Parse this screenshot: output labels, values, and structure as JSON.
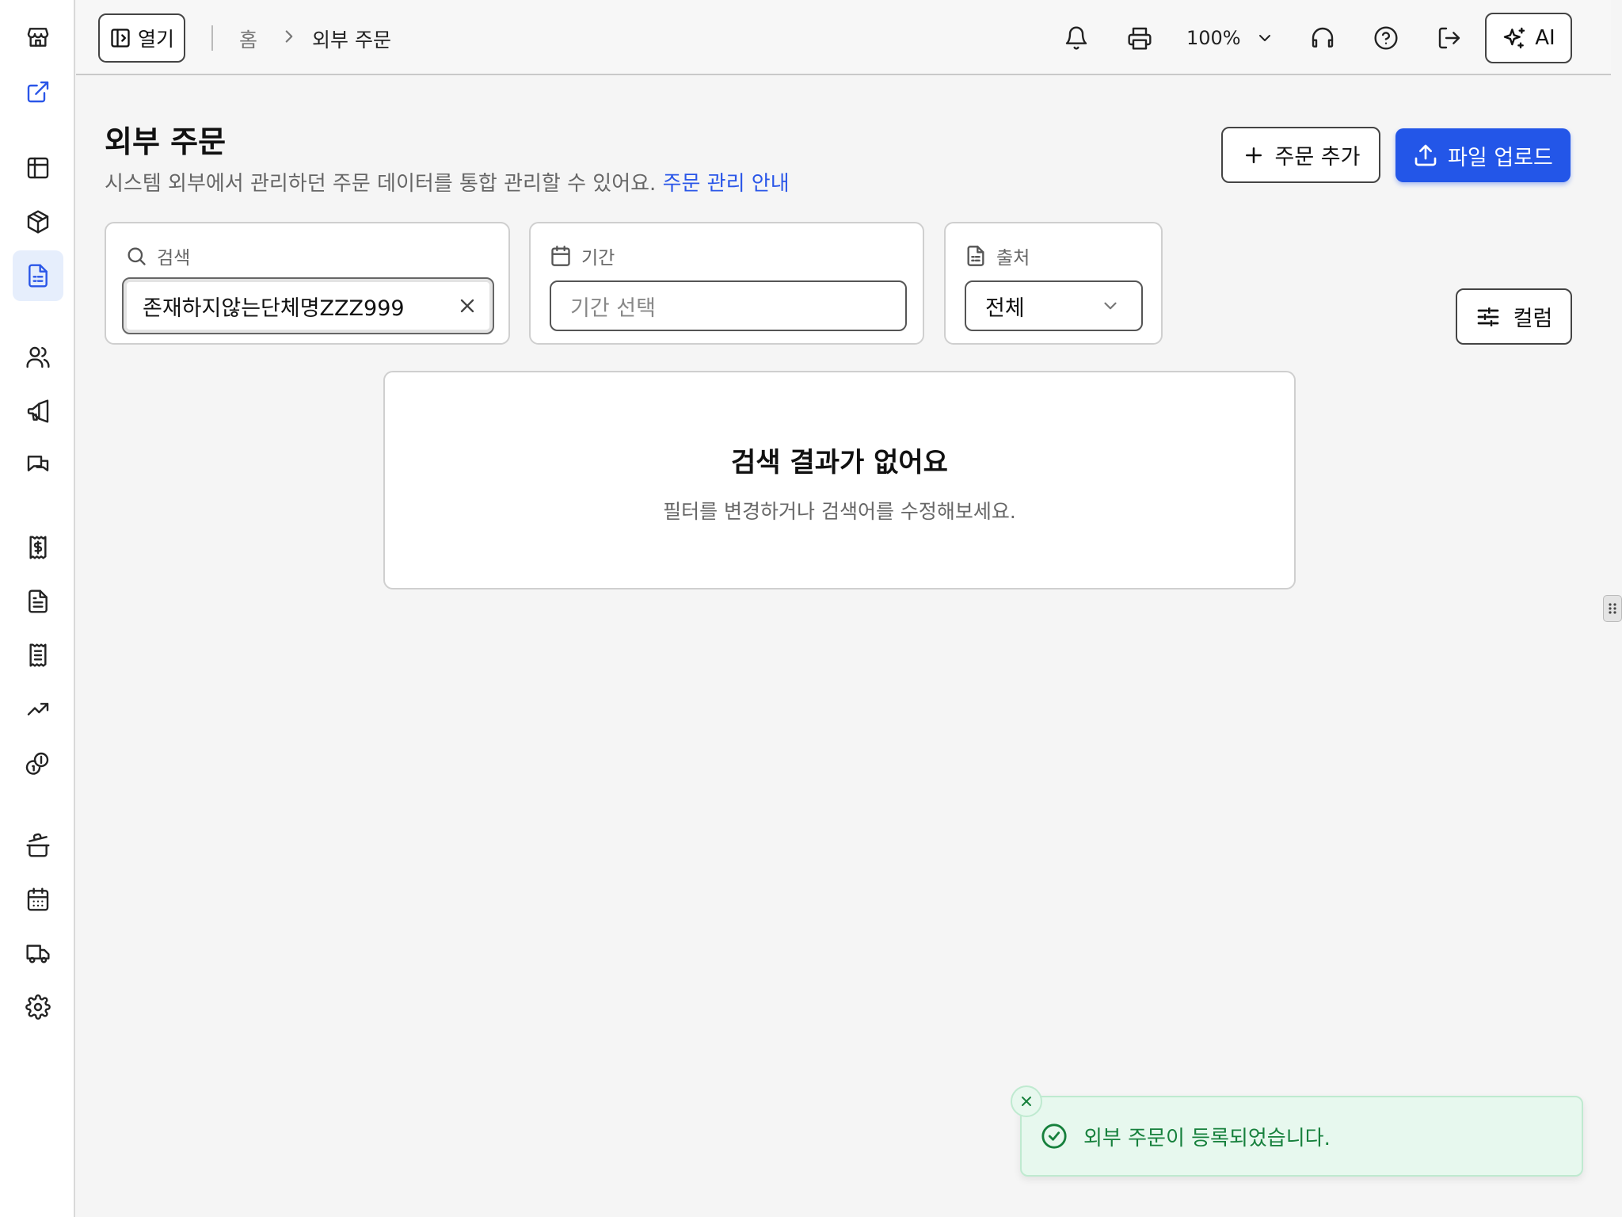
{
  "topbar": {
    "open_label": "열기",
    "breadcrumb_home": "홈",
    "breadcrumb_current": "외부 주문",
    "zoom_level": "100%",
    "ai_label": "AI"
  },
  "page": {
    "title": "외부 주문",
    "subtitle": "시스템 외부에서 관리하던 주문 데이터를 통합 관리할 수 있어요.",
    "guide_link": "주문 관리 안내",
    "add_order_label": "주문 추가",
    "upload_label": "파일 업로드",
    "columns_label": "컬럼"
  },
  "filters": {
    "search": {
      "label": "검색",
      "value": "존재하지않는단체명ZZZ999"
    },
    "period": {
      "label": "기간",
      "placeholder": "기간 선택"
    },
    "source": {
      "label": "출처",
      "value": "전체"
    }
  },
  "empty_state": {
    "title": "검색 결과가 없어요",
    "description": "필터를 변경하거나 검색어를 수정해보세요."
  },
  "toast": {
    "message": "외부 주문이 등록되었습니다."
  },
  "colors": {
    "primary": "#2356e8",
    "success": "#16803c",
    "success_bg": "#e7f8ee"
  },
  "sidebar_icons": [
    "store-icon",
    "external-link-icon",
    "table-icon",
    "package-icon",
    "document-list-icon",
    "users-icon",
    "megaphone-icon",
    "messages-icon",
    "receipt-dollar-icon",
    "file-text-icon",
    "clipboard-list-icon",
    "trending-up-icon",
    "coins-icon",
    "cooking-pot-icon",
    "calendar-icon",
    "truck-icon",
    "settings-icon"
  ]
}
